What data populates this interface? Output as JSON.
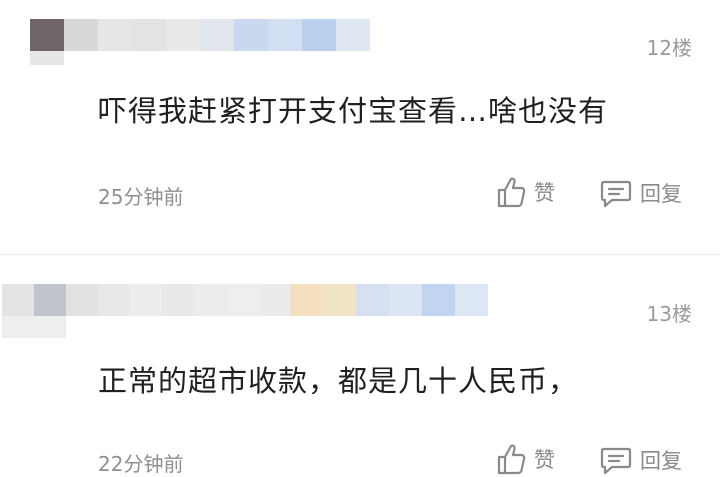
{
  "comments": [
    {
      "floor": "12楼",
      "text": "吓得我赶紧打开支付宝查看…啥也没有",
      "time": "25分钟前",
      "like_label": "赞",
      "reply_label": "回复",
      "blur_colors": [
        "#6f6466",
        "#d8d8d8",
        "#e6e6e6",
        "#e3e3e3",
        "#e9e9e9",
        "#e1e6ee",
        "#c9d8ef",
        "#d2def1",
        "#b9cfee",
        "#dfe7f3"
      ]
    },
    {
      "floor": "13楼",
      "text": "正常的超市收款，都是几十人民币，",
      "time": "22分钟前",
      "like_label": "赞",
      "reply_label": "回复",
      "blur_colors": [
        "#e4e4e6",
        "#c0c4cc",
        "#e2e2e2",
        "#e8e8e8",
        "#ededed",
        "#f4e0be",
        "#f1e3c6",
        "#d5e1f2",
        "#dbe5f3",
        "#c2d4ef",
        "#dde6f3"
      ]
    }
  ],
  "colors": {
    "text": "#1f1f1f",
    "meta": "#8f8f8f",
    "divider": "#ececec"
  }
}
